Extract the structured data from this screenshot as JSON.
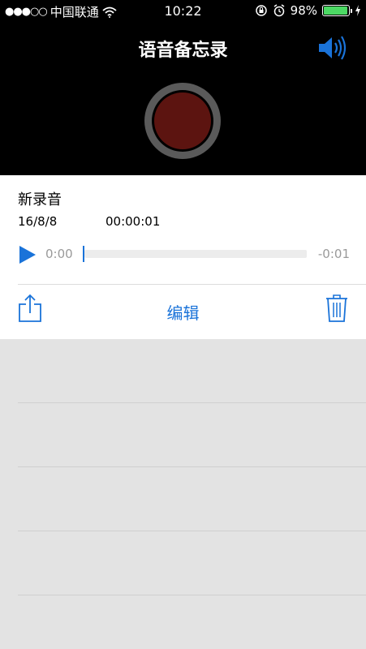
{
  "status_bar": {
    "signal": "●●●○○",
    "carrier": "中国联通",
    "time": "10:22",
    "battery": "98%",
    "battery_level": 0.98
  },
  "header": {
    "title": "语音备忘录"
  },
  "recording": {
    "name": "新录音",
    "date": "16/8/8",
    "duration": "00:00:01",
    "elapsed": "0:00",
    "remaining": "-0:01",
    "progress": 0.0
  },
  "actions": {
    "edit_label": "编辑"
  },
  "colors": {
    "accent": "#1a73d9",
    "record": "#5c1410",
    "battery": "#4cd964"
  }
}
